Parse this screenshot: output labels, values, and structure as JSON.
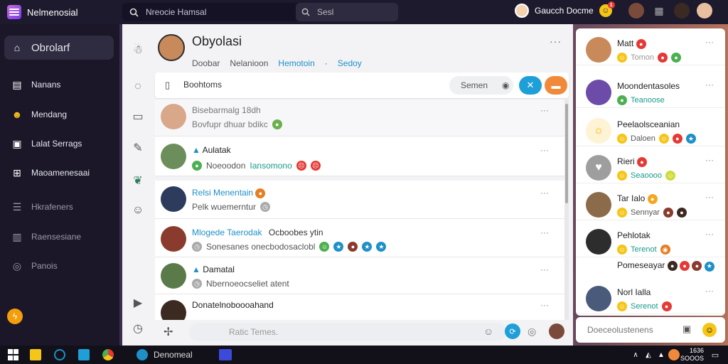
{
  "topbar": {
    "app_title": "Nelmenosial",
    "search_placeholder": "Nreocie Hamsal",
    "search_inner_label": "Sesl",
    "user_name": "Gaucch Docme",
    "notification_badge": "1"
  },
  "sidebar": {
    "items": [
      {
        "label": "Obrolarf",
        "icon": "home-icon"
      },
      {
        "label": "Nanans",
        "icon": "inbox-icon"
      },
      {
        "label": "Mendang",
        "icon": "emoji-icon"
      },
      {
        "label": "Lalat Serrags",
        "icon": "folder-icon"
      },
      {
        "label": "Maoamenesaai",
        "icon": "grid-icon"
      },
      {
        "label": "Hkrafeners",
        "icon": "list-icon"
      },
      {
        "label": "Raensesiane",
        "icon": "table-icon"
      },
      {
        "label": "Panois",
        "icon": "settings-icon"
      }
    ]
  },
  "conversation": {
    "title": "Obyolasi",
    "sub_1": "Doobar",
    "sub_2": "Nelanioon",
    "sub_3": "Hemotoin",
    "sub_sep": "·",
    "sub_4": "Sedoy",
    "more": "···"
  },
  "filter_bar": {
    "label": "Boohtoms",
    "search_label": "Semen"
  },
  "messages": [
    {
      "name": "Bisebarmalg 18dh",
      "text": "Bovfupr dhuar bdikc",
      "name_style": "gray"
    },
    {
      "name": "Aulatak",
      "text": "Noeoodon",
      "text_highlight": "Iansomono"
    },
    {
      "name": "Relsi Menentain",
      "text": "Pelk wuemerntur",
      "name_style": "blue"
    },
    {
      "name": "Mlogede Taerodak",
      "name_extra": "Ocboobes ytin",
      "text": "Sonesanes onecbodosaclobl",
      "name_style": "blue"
    },
    {
      "name": "Damatal",
      "text": "Nbernoeocseliet atent"
    },
    {
      "name": "Donatelnoboooahand",
      "text": ""
    }
  ],
  "composer": {
    "placeholder": "Ratic Temes."
  },
  "contacts": [
    {
      "name": "Matt",
      "status": "Tomon",
      "status_style": "gray"
    },
    {
      "name": "Moondentasoles",
      "status": "Teanoose",
      "status_style": "teal"
    },
    {
      "name": "Peelaolsceanian",
      "status": "Daloen",
      "status_style": "gray"
    },
    {
      "name": "Rieri",
      "status": "Seaoooo",
      "status_style": "teal"
    },
    {
      "name": "Tar Ialo",
      "status": "Sennyar",
      "status_style": "gray"
    },
    {
      "name": "Pehlotak",
      "status": "Terenot",
      "status_style": "teal"
    },
    {
      "name": "Pomeseayar",
      "status": "",
      "status_style": "gray"
    },
    {
      "name": "Norl Ialla",
      "status": "Serenot",
      "status_style": "teal"
    }
  ],
  "contacts_footer": {
    "label": "Doeceolustenens"
  },
  "taskbar": {
    "active_app": "Denomeal",
    "clock_line1": "1636",
    "clock_line2": "SOOOS"
  },
  "colors": {
    "accent_blue": "#1e90c8",
    "accent_teal": "#1a9a8a",
    "sidebar_bg": "#1b1729",
    "topbar_bg": "#1e1a2e"
  }
}
